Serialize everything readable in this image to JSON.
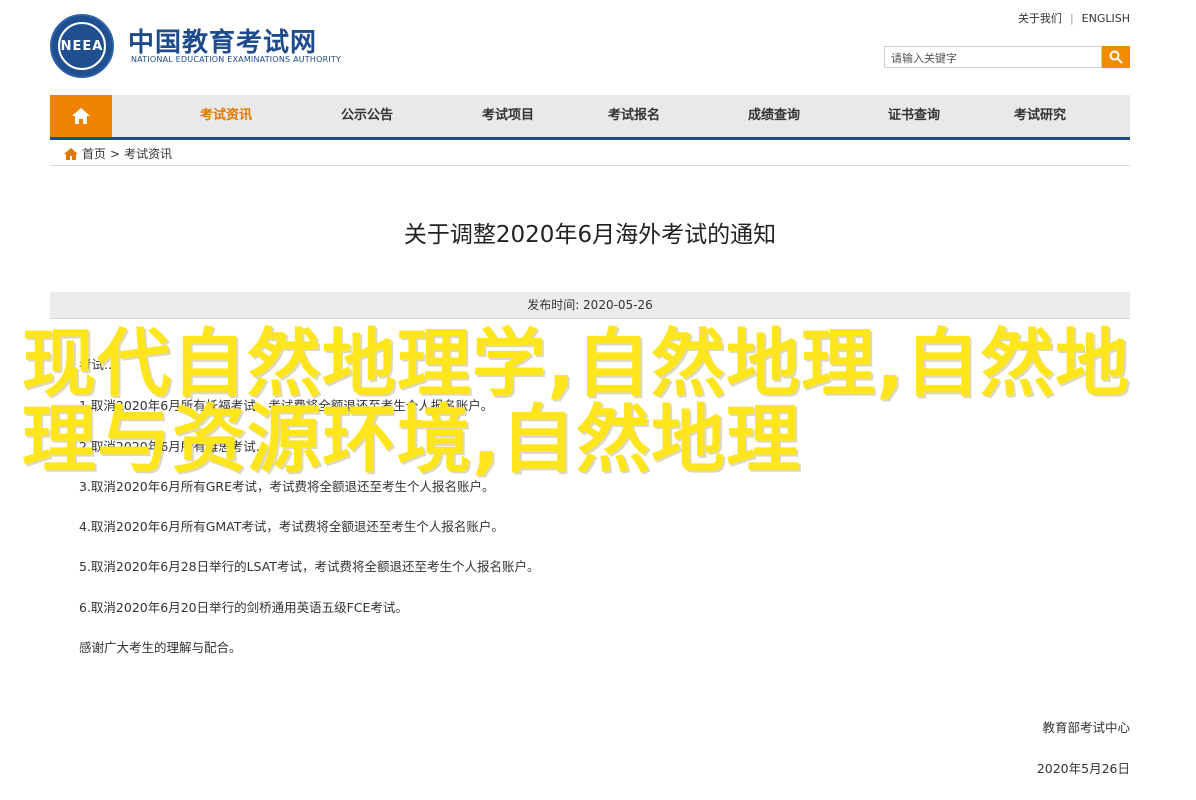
{
  "header": {
    "logo_emblem_text": "NEEA",
    "logo_cn": "中国教育考试网",
    "logo_en": "NATIONAL EDUCATION EXAMINATIONS AUTHORITY",
    "top_links": [
      "关于我们",
      "ENGLISH"
    ],
    "search_placeholder": "请输入关键字"
  },
  "nav": {
    "items": [
      "考试资讯",
      "公示公告",
      "考试项目",
      "考试报名",
      "成绩查询",
      "证书查询",
      "考试研究"
    ],
    "active": "考试资讯",
    "accent_color": "#f08300",
    "bar_color": "#1e4b8c"
  },
  "breadcrumb": [
    "首页",
    ">",
    "考试资讯"
  ],
  "article": {
    "title": "关于调整2020年6月海外考试的通知",
    "publish_label": "发布时间: 2020-05-26",
    "visible_lines": {
      "line1": "考试...",
      "line2": "1.取消2020年6月所有托福考试，考试费将全额退还至考生个人报名账户。",
      "line3": "2.取消2020年6月所有雅思考试...",
      "line4": "3.取消2020年6月所有GRE考试，考试费将全额退还至考生个人报名账户。"
    },
    "items": [
      "4.取消2020年6月所有GMAT考试，考试费将全额退还至考生个人报名账户。",
      "5.取消2020年6月28日举行的LSAT考试，考试费将全额退还至考生个人报名账户。",
      "6.取消2020年6月20日举行的剑桥通用英语五级FCE考试。",
      "感谢广大考生的理解与配合。"
    ],
    "signature_org": "教育部考试中心",
    "signature_date": "2020年5月26日"
  },
  "overlay_text": "现代自然地理学,自然地理,自然地理与资源环境,自然地理"
}
